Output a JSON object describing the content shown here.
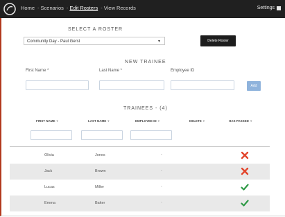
{
  "nav": {
    "items": [
      {
        "label": "Home"
      },
      {
        "label": "Scenarios"
      },
      {
        "label": "Edit Rosters"
      },
      {
        "label": "View Records"
      }
    ],
    "separator": "-",
    "settings_label": "Settings"
  },
  "roster": {
    "heading": "SELECT A ROSTER",
    "selected_value": "Community Day - Paul Gerst",
    "action_label": "Delete Roster"
  },
  "new_trainee": {
    "heading": "NEW TRAINEE",
    "first_name_label": "First Name *",
    "last_name_label": "Last Name *",
    "employee_id_label": "Employee ID",
    "add_label": "Add"
  },
  "trainees": {
    "heading": "TRAINEES - (4)",
    "columns": [
      "FIRST NAME",
      "LAST NAME",
      "EMPLOYEE ID",
      "DELETE",
      "HAS PASSED"
    ],
    "rows": [
      {
        "first": "Olivia",
        "last": "Jones",
        "employee_id": "-",
        "passed": false
      },
      {
        "first": "Jack",
        "last": "Brown",
        "employee_id": "-",
        "passed": false
      },
      {
        "first": "Lucas",
        "last": "Miller",
        "employee_id": "-",
        "passed": true
      },
      {
        "first": "Emma",
        "last": "Baker",
        "employee_id": "-",
        "passed": true
      }
    ]
  },
  "colors": {
    "fail": "#e2452c",
    "pass": "#2f9a47",
    "accent": "#b23a1e"
  },
  "icons": {
    "fail": "x-icon",
    "pass": "check-icon",
    "logo": "app-logo-icon",
    "settings": "settings-icon"
  }
}
